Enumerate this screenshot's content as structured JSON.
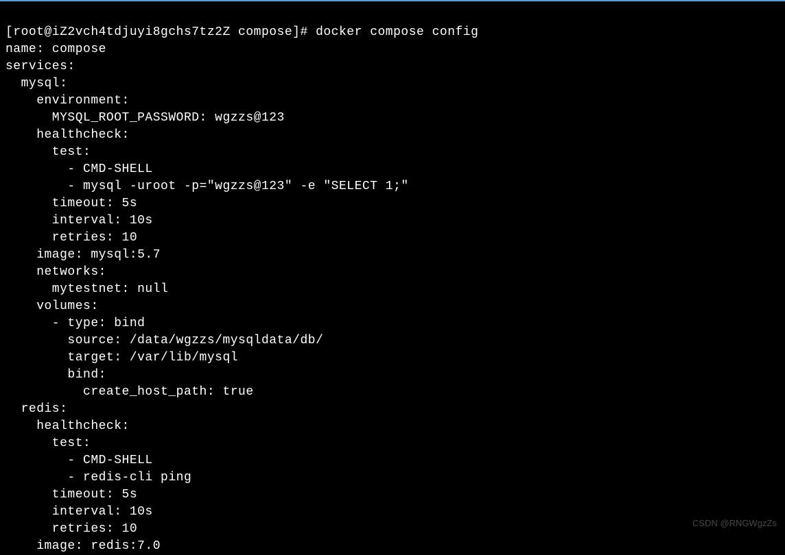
{
  "terminal": {
    "prompt": "[root@iZ2vch4tdjuyi8gchs7tz2Z compose]# ",
    "command": "docker compose config",
    "output": {
      "name_line": "name: compose",
      "services_line": "services:",
      "mysql": {
        "header": "  mysql:",
        "environment": {
          "header": "    environment:",
          "password": "      MYSQL_ROOT_PASSWORD: wgzzs@123"
        },
        "healthcheck": {
          "header": "    healthcheck:",
          "test_header": "      test:",
          "test_cmd": "        - CMD-SHELL",
          "test_query": "        - mysql -uroot -p=\"wgzzs@123\" -e \"SELECT 1;\"",
          "timeout": "      timeout: 5s",
          "interval": "      interval: 10s",
          "retries": "      retries: 10"
        },
        "image": "    image: mysql:5.7",
        "networks": {
          "header": "    networks:",
          "mytestnet": "      mytestnet: null"
        },
        "volumes": {
          "header": "    volumes:",
          "type": "      - type: bind",
          "source": "        source: /data/wgzzs/mysqldata/db/",
          "target": "        target: /var/lib/mysql",
          "bind_header": "        bind:",
          "create_host_path": "          create_host_path: true"
        }
      },
      "redis": {
        "header": "  redis:",
        "healthcheck": {
          "header": "    healthcheck:",
          "test_header": "      test:",
          "test_cmd": "        - CMD-SHELL",
          "test_ping": "        - redis-cli ping",
          "timeout": "      timeout: 5s",
          "interval": "      interval: 10s",
          "retries": "      retries: 10"
        },
        "image": "    image: redis:7.0"
      }
    }
  },
  "watermark": "CSDN @RNGWgzZs"
}
